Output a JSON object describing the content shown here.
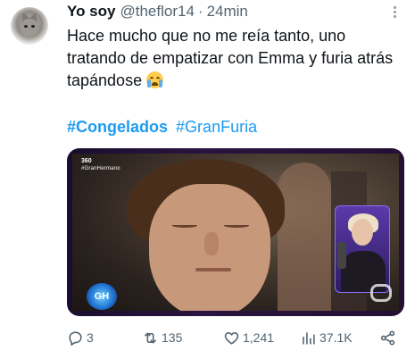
{
  "tweet": {
    "author_name": "Yo soy",
    "author_handle": "@theflor14",
    "separator": "·",
    "timestamp": "24min",
    "text": "Hace mucho que no me reía tanto, uno tratando de empatizar con Emma y furia atrás tapándose",
    "emoji": "crying-face",
    "hashtags": [
      "#Congelados",
      "#GranFuria"
    ]
  },
  "media": {
    "channel_bug": "360",
    "hashtag_bug": "#GranHermano",
    "show_logo": "GH"
  },
  "actions": {
    "replies": "3",
    "retweets": "135",
    "likes": "1,241",
    "views": "37.1K"
  },
  "colors": {
    "link": "#1d9bf0",
    "muted": "#536471",
    "text": "#0f1419"
  }
}
